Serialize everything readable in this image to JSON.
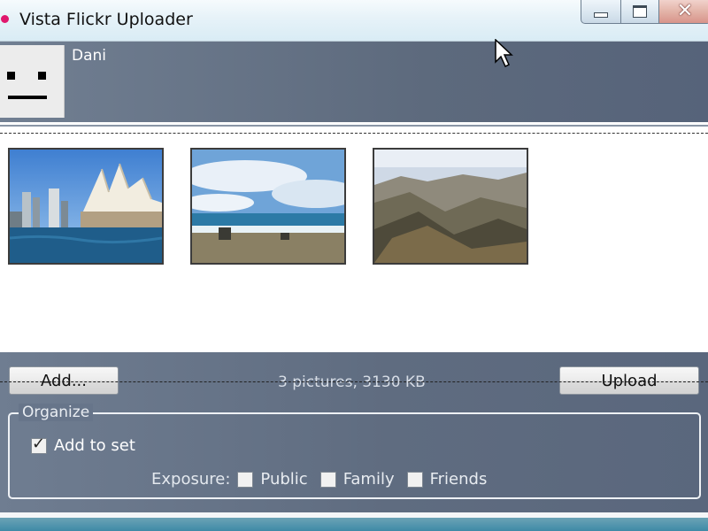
{
  "window": {
    "title": "Vista Flickr Uploader",
    "icons": {
      "minimize": "minimize-icon",
      "maximize": "maximize-icon",
      "close": "close-icon"
    }
  },
  "user": {
    "name": "Dani",
    "avatar_icon": "robot-face-icon"
  },
  "photos": [
    {
      "name": "sydney-opera-house-thumbnail"
    },
    {
      "name": "beach-thumbnail"
    },
    {
      "name": "canyon-thumbnail"
    }
  ],
  "actions": {
    "add_label": "Add...",
    "upload_label": "Upload",
    "status": "3 pictures, 3130 KB"
  },
  "organize": {
    "legend": "Organize",
    "add_to_set": {
      "label": "Add to set",
      "checked": true
    },
    "exposure_label": "Exposure:",
    "exposure_options": [
      {
        "label": "Public",
        "checked": false
      },
      {
        "label": "Family",
        "checked": false
      },
      {
        "label": "Friends",
        "checked": false
      }
    ]
  },
  "colors": {
    "header": "#5d6a7d",
    "app_dot": "#e0176d",
    "titlebar": "#e6f2f8"
  }
}
